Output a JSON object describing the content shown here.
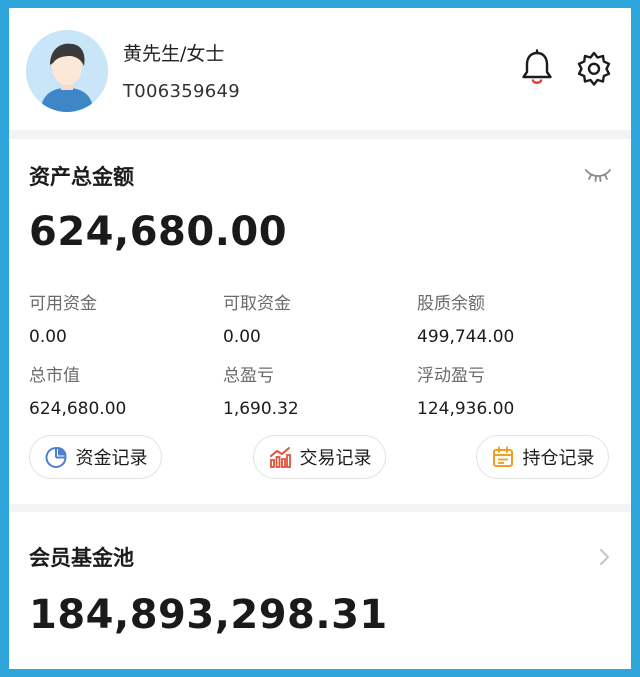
{
  "profile": {
    "name": "黄先生/女士",
    "account_id": "T006359649"
  },
  "assets": {
    "title": "资产总金额",
    "total": "624,680.00",
    "stats": [
      {
        "label": "可用资金",
        "value": "0.00"
      },
      {
        "label": "可取资金",
        "value": "0.00"
      },
      {
        "label": "股质余额",
        "value": "499,744.00"
      },
      {
        "label": "总市值",
        "value": "624,680.00"
      },
      {
        "label": "总盈亏",
        "value": "1,690.32"
      },
      {
        "label": "浮动盈亏",
        "value": "124,936.00"
      }
    ],
    "buttons": {
      "fund_records": "资金记录",
      "trade_records": "交易记录",
      "position_records": "持仓记录"
    }
  },
  "member_pool": {
    "title": "会员基金池",
    "amount": "184,893,298.31"
  },
  "icons": {
    "bell": "bell-icon",
    "settings": "gear-icon",
    "visibility": "eye-closed-icon",
    "fund": "pie-chart-icon",
    "trade": "bar-chart-icon",
    "position": "calendar-icon",
    "chevron": "chevron-right-icon"
  },
  "colors": {
    "frame": "#2ea6dc",
    "bell_accent": "#e53935",
    "pie_blue": "#4f7fcf",
    "trade_red": "#e0523f",
    "position_orange": "#f0a020"
  }
}
